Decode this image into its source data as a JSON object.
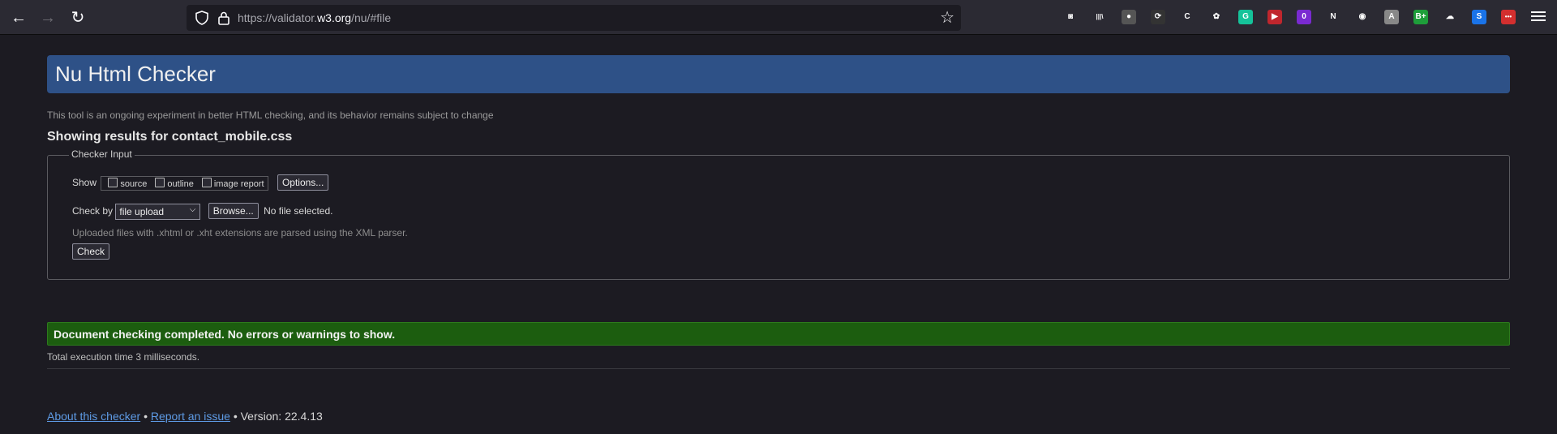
{
  "browser": {
    "url_prefix": "https://validator.",
    "url_domain": "w3.org",
    "url_suffix": "/nu/#file",
    "extensions": [
      {
        "name": "pocket-icon",
        "color": "#2b2a33",
        "glyph": "◙"
      },
      {
        "name": "library-icon",
        "color": "#2b2a33",
        "glyph": "|||\\"
      },
      {
        "name": "extension-1-icon",
        "color": "#555",
        "glyph": "●"
      },
      {
        "name": "extension-2-icon",
        "color": "#333",
        "glyph": "⟳"
      },
      {
        "name": "extension-c-icon",
        "color": "#2b2a33",
        "glyph": "C"
      },
      {
        "name": "cookie-icon",
        "color": "#2b2a33",
        "glyph": "✿"
      },
      {
        "name": "grammarly-icon",
        "color": "#15c39a",
        "glyph": "G"
      },
      {
        "name": "extension-red-icon",
        "color": "#c0262d",
        "glyph": "▶"
      },
      {
        "name": "extension-purple-icon",
        "color": "#7a2ad1",
        "glyph": "0"
      },
      {
        "name": "netflix-icon",
        "color": "#2b2a33",
        "glyph": "N"
      },
      {
        "name": "extension-eyes-icon",
        "color": "#2b2a33",
        "glyph": "◉"
      },
      {
        "name": "extension-a-icon",
        "color": "#888",
        "glyph": "A"
      },
      {
        "name": "extension-b-icon",
        "color": "#1e9e3a",
        "glyph": "B+"
      },
      {
        "name": "extension-shoe-icon",
        "color": "#2b2a33",
        "glyph": "☁"
      },
      {
        "name": "extension-s-icon",
        "color": "#1a73e8",
        "glyph": "S"
      },
      {
        "name": "extension-dots-icon",
        "color": "#d32f2f",
        "glyph": "•••"
      }
    ],
    "badge_count": "0"
  },
  "page": {
    "title": "Nu Html Checker",
    "disclaimer": "This tool is an ongoing experiment in better HTML checking, and its behavior remains subject to change",
    "results_title": "Showing results for contact_mobile.css",
    "checker": {
      "legend": "Checker Input",
      "show_label": "Show",
      "options": [
        "source",
        "outline",
        "image report"
      ],
      "options_button": "Options...",
      "check_by_label": "Check by",
      "check_by_value": "file upload",
      "browse_button": "Browse...",
      "no_file": "No file selected.",
      "note": "Uploaded files with .xhtml or .xht extensions are parsed using the XML parser.",
      "check_button": "Check"
    },
    "success_message": "Document checking completed. No errors or warnings to show.",
    "execution_time": "Total execution time 3 milliseconds.",
    "footer": {
      "about_link": "About this checker",
      "separator": "•",
      "report_link": "Report an issue",
      "version": "Version: 22.4.13"
    }
  }
}
